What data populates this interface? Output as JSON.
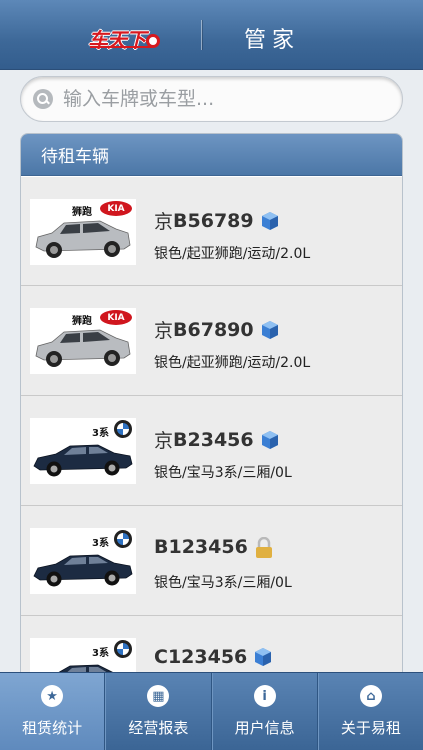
{
  "header": {
    "brand": "车天下",
    "title": "管家"
  },
  "search": {
    "placeholder": "输入车牌或车型..."
  },
  "panel": {
    "title": "待租车辆"
  },
  "cars": [
    {
      "province": "京",
      "plate": "B56789",
      "desc": "银色/起亚狮跑/运动/2.0L",
      "status": "cube-icon",
      "logo_model": "狮跑",
      "logo_brand": "KIA",
      "body": "suv"
    },
    {
      "province": "京",
      "plate": "B67890",
      "desc": "银色/起亚狮跑/运动/2.0L",
      "status": "cube-icon",
      "logo_model": "狮跑",
      "logo_brand": "KIA",
      "body": "suv"
    },
    {
      "province": "京",
      "plate": "B23456",
      "desc": "银色/宝马3系/三厢/0L",
      "status": "cube-icon",
      "logo_model": "3系",
      "logo_brand": "BMW",
      "body": "sedan"
    },
    {
      "province": "",
      "plate": "B123456",
      "desc": "银色/宝马3系/三厢/0L",
      "status": "lock-icon",
      "logo_model": "3系",
      "logo_brand": "BMW",
      "body": "sedan"
    },
    {
      "province": "",
      "plate": "C123456",
      "desc": "",
      "status": "cube-icon",
      "logo_model": "3系",
      "logo_brand": "BMW",
      "body": "sedan"
    }
  ],
  "tabs": [
    {
      "label": "租赁统计",
      "icon": "star-icon",
      "active": true
    },
    {
      "label": "经营报表",
      "icon": "grid-icon",
      "active": false
    },
    {
      "label": "用户信息",
      "icon": "info-icon",
      "active": false
    },
    {
      "label": "关于易租",
      "icon": "home-icon",
      "active": false
    }
  ],
  "colors": {
    "header": "#3d6898",
    "brand_red": "#d7191f",
    "status_blue": "#3b7fd4",
    "lock_gold": "#e0b040"
  }
}
